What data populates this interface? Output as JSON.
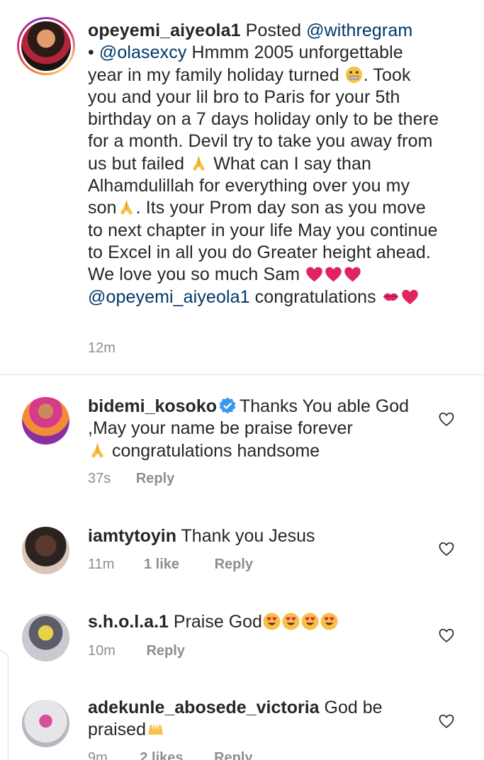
{
  "caption": {
    "username": "opeyemi_aiyeola1",
    "posted_word": "Posted",
    "via_mention": "@withregram",
    "bullet": "•",
    "source_mention": "@olasexcy",
    "body_1": "Hmmm 2005 unforgettable year in my family holiday turned",
    "body_2": ". Took you and your lil bro to Paris for your 5th birthday on a 7 days holiday only to be there for a month. Devil try to take you away from us but failed",
    "body_3": "What can I say than Alhamdulillah for everything over you my son",
    "body_4": ". Its your Prom day son as you move to next chapter in your life May you continue to Excel in all you do Greater height ahead. We love you so much Sam",
    "end_mention": "@opeyemi_aiyeola1",
    "body_5": "congratulations",
    "time": "12m"
  },
  "comments": [
    {
      "username": "bidemi_kosoko",
      "text_1": "Thanks You able God ,May your name be praise forever",
      "text_2": "congratulations  handsome",
      "time": "37s",
      "likes": "",
      "reply": "Reply"
    },
    {
      "username": "iamtytoyin",
      "text_1": "Thank you Jesus",
      "time": "11m",
      "likes": "1 like",
      "reply": "Reply"
    },
    {
      "username": "s.h.o.l.a.1",
      "text_1": "Praise God",
      "time": "10m",
      "likes": "",
      "reply": "Reply"
    },
    {
      "username": "adekunle_abosede_victoria",
      "text_1": "God be praised",
      "time": "9m",
      "likes": "2 likes",
      "reply": "Reply"
    }
  ],
  "colors": {
    "link": "#00376b",
    "meta": "#8e8e8e",
    "heart": "#e0245e",
    "verified": "#3897f0"
  }
}
